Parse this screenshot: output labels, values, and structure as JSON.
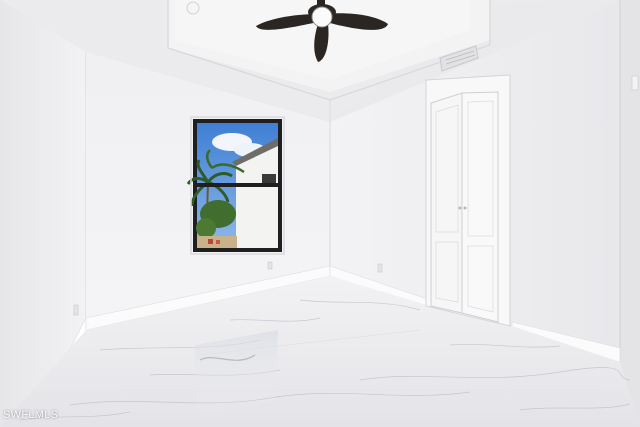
{
  "photo": {
    "subject": "empty-bedroom-interior",
    "watermark": "SWFLMLS"
  },
  "icons": [
    "ceiling-fan-icon",
    "air-vent-icon",
    "outlet-icon"
  ],
  "colors": {
    "wall": "#f1f1f3",
    "ceiling": "#eeeeef",
    "floor": "#e9e9ec",
    "window_frame": "#1f1f22",
    "sky": "#4a86d6",
    "door": "#f7f7f8"
  }
}
